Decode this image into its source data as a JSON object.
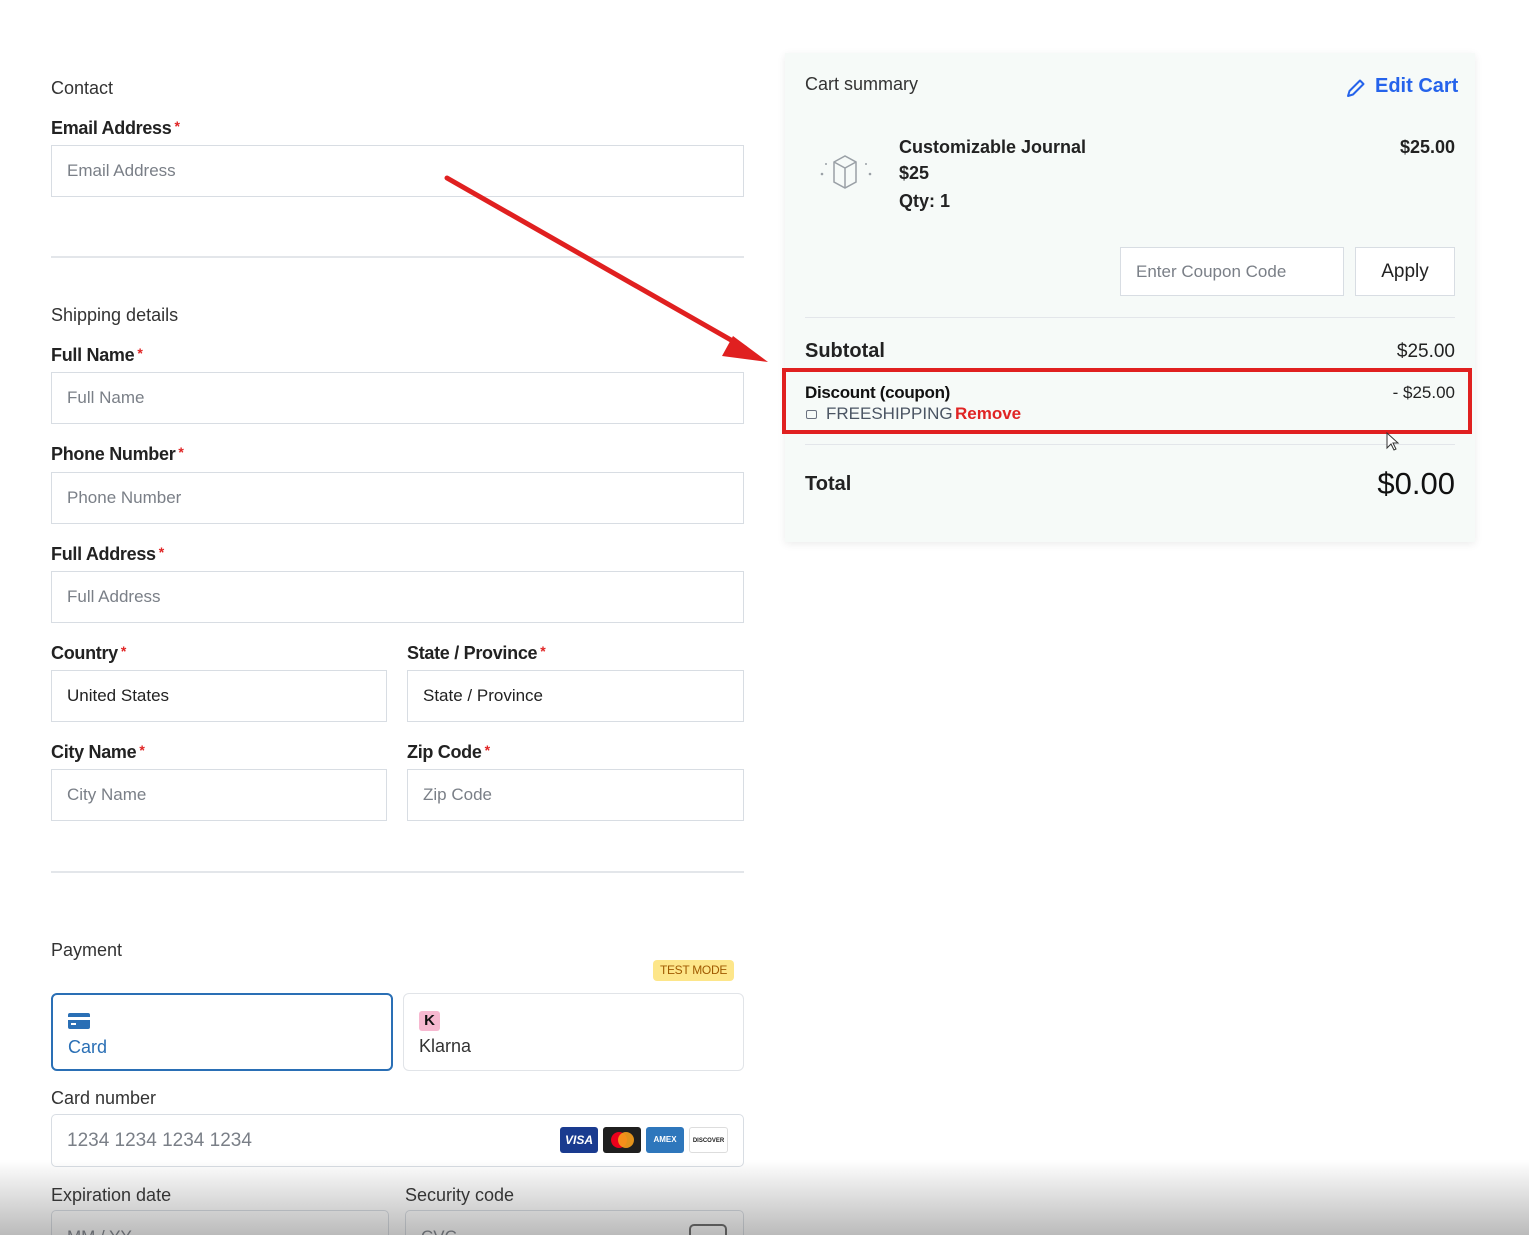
{
  "contact": {
    "section_title": "Contact",
    "email_label": "Email Address",
    "email_placeholder": "Email Address"
  },
  "shipping": {
    "section_title": "Shipping details",
    "full_name_label": "Full Name",
    "full_name_placeholder": "Full Name",
    "phone_label": "Phone Number",
    "phone_placeholder": "Phone Number",
    "address_label": "Full Address",
    "address_placeholder": "Full Address",
    "country_label": "Country",
    "country_value": "United States",
    "state_label": "State / Province",
    "state_value": "State / Province",
    "city_label": "City Name",
    "city_placeholder": "City Name",
    "zip_label": "Zip Code",
    "zip_placeholder": "Zip Code",
    "required_mark": "*"
  },
  "payment": {
    "section_title": "Payment",
    "test_mode_badge": "TEST MODE",
    "tabs": [
      {
        "label": "Card",
        "icon": "credit-card-icon",
        "active": true
      },
      {
        "label": "Klarna",
        "icon": "klarna-icon",
        "active": false
      }
    ],
    "klarna_glyph": "K",
    "card_number_label": "Card number",
    "card_number_placeholder": "1234 1234 1234 1234",
    "card_brands": [
      "VISA",
      "MC",
      "AMEX",
      "DISCOVER"
    ],
    "expiration_label": "Expiration date",
    "expiration_placeholder": "MM / YY",
    "security_label": "Security code",
    "security_placeholder": "CVC"
  },
  "cart": {
    "title": "Cart summary",
    "edit_label": "Edit Cart",
    "item": {
      "name": "Customizable Journal",
      "price": "$25",
      "qty": "Qty: 1",
      "line_total": "$25.00"
    },
    "coupon_placeholder": "Enter Coupon Code",
    "apply_label": "Apply",
    "subtotal_label": "Subtotal",
    "subtotal_value": "$25.00",
    "discount_label": "Discount (coupon)",
    "discount_value": "- $25.00",
    "coupon_code": "FREESHIPPING",
    "remove_label": "Remove",
    "total_label": "Total",
    "total_value": "$0.00"
  },
  "colors": {
    "accent_blue": "#2a6fb5",
    "link_blue": "#2563eb",
    "highlight_red": "#e02020",
    "remove_red": "#e02424",
    "badge_bg": "#fde68a"
  }
}
